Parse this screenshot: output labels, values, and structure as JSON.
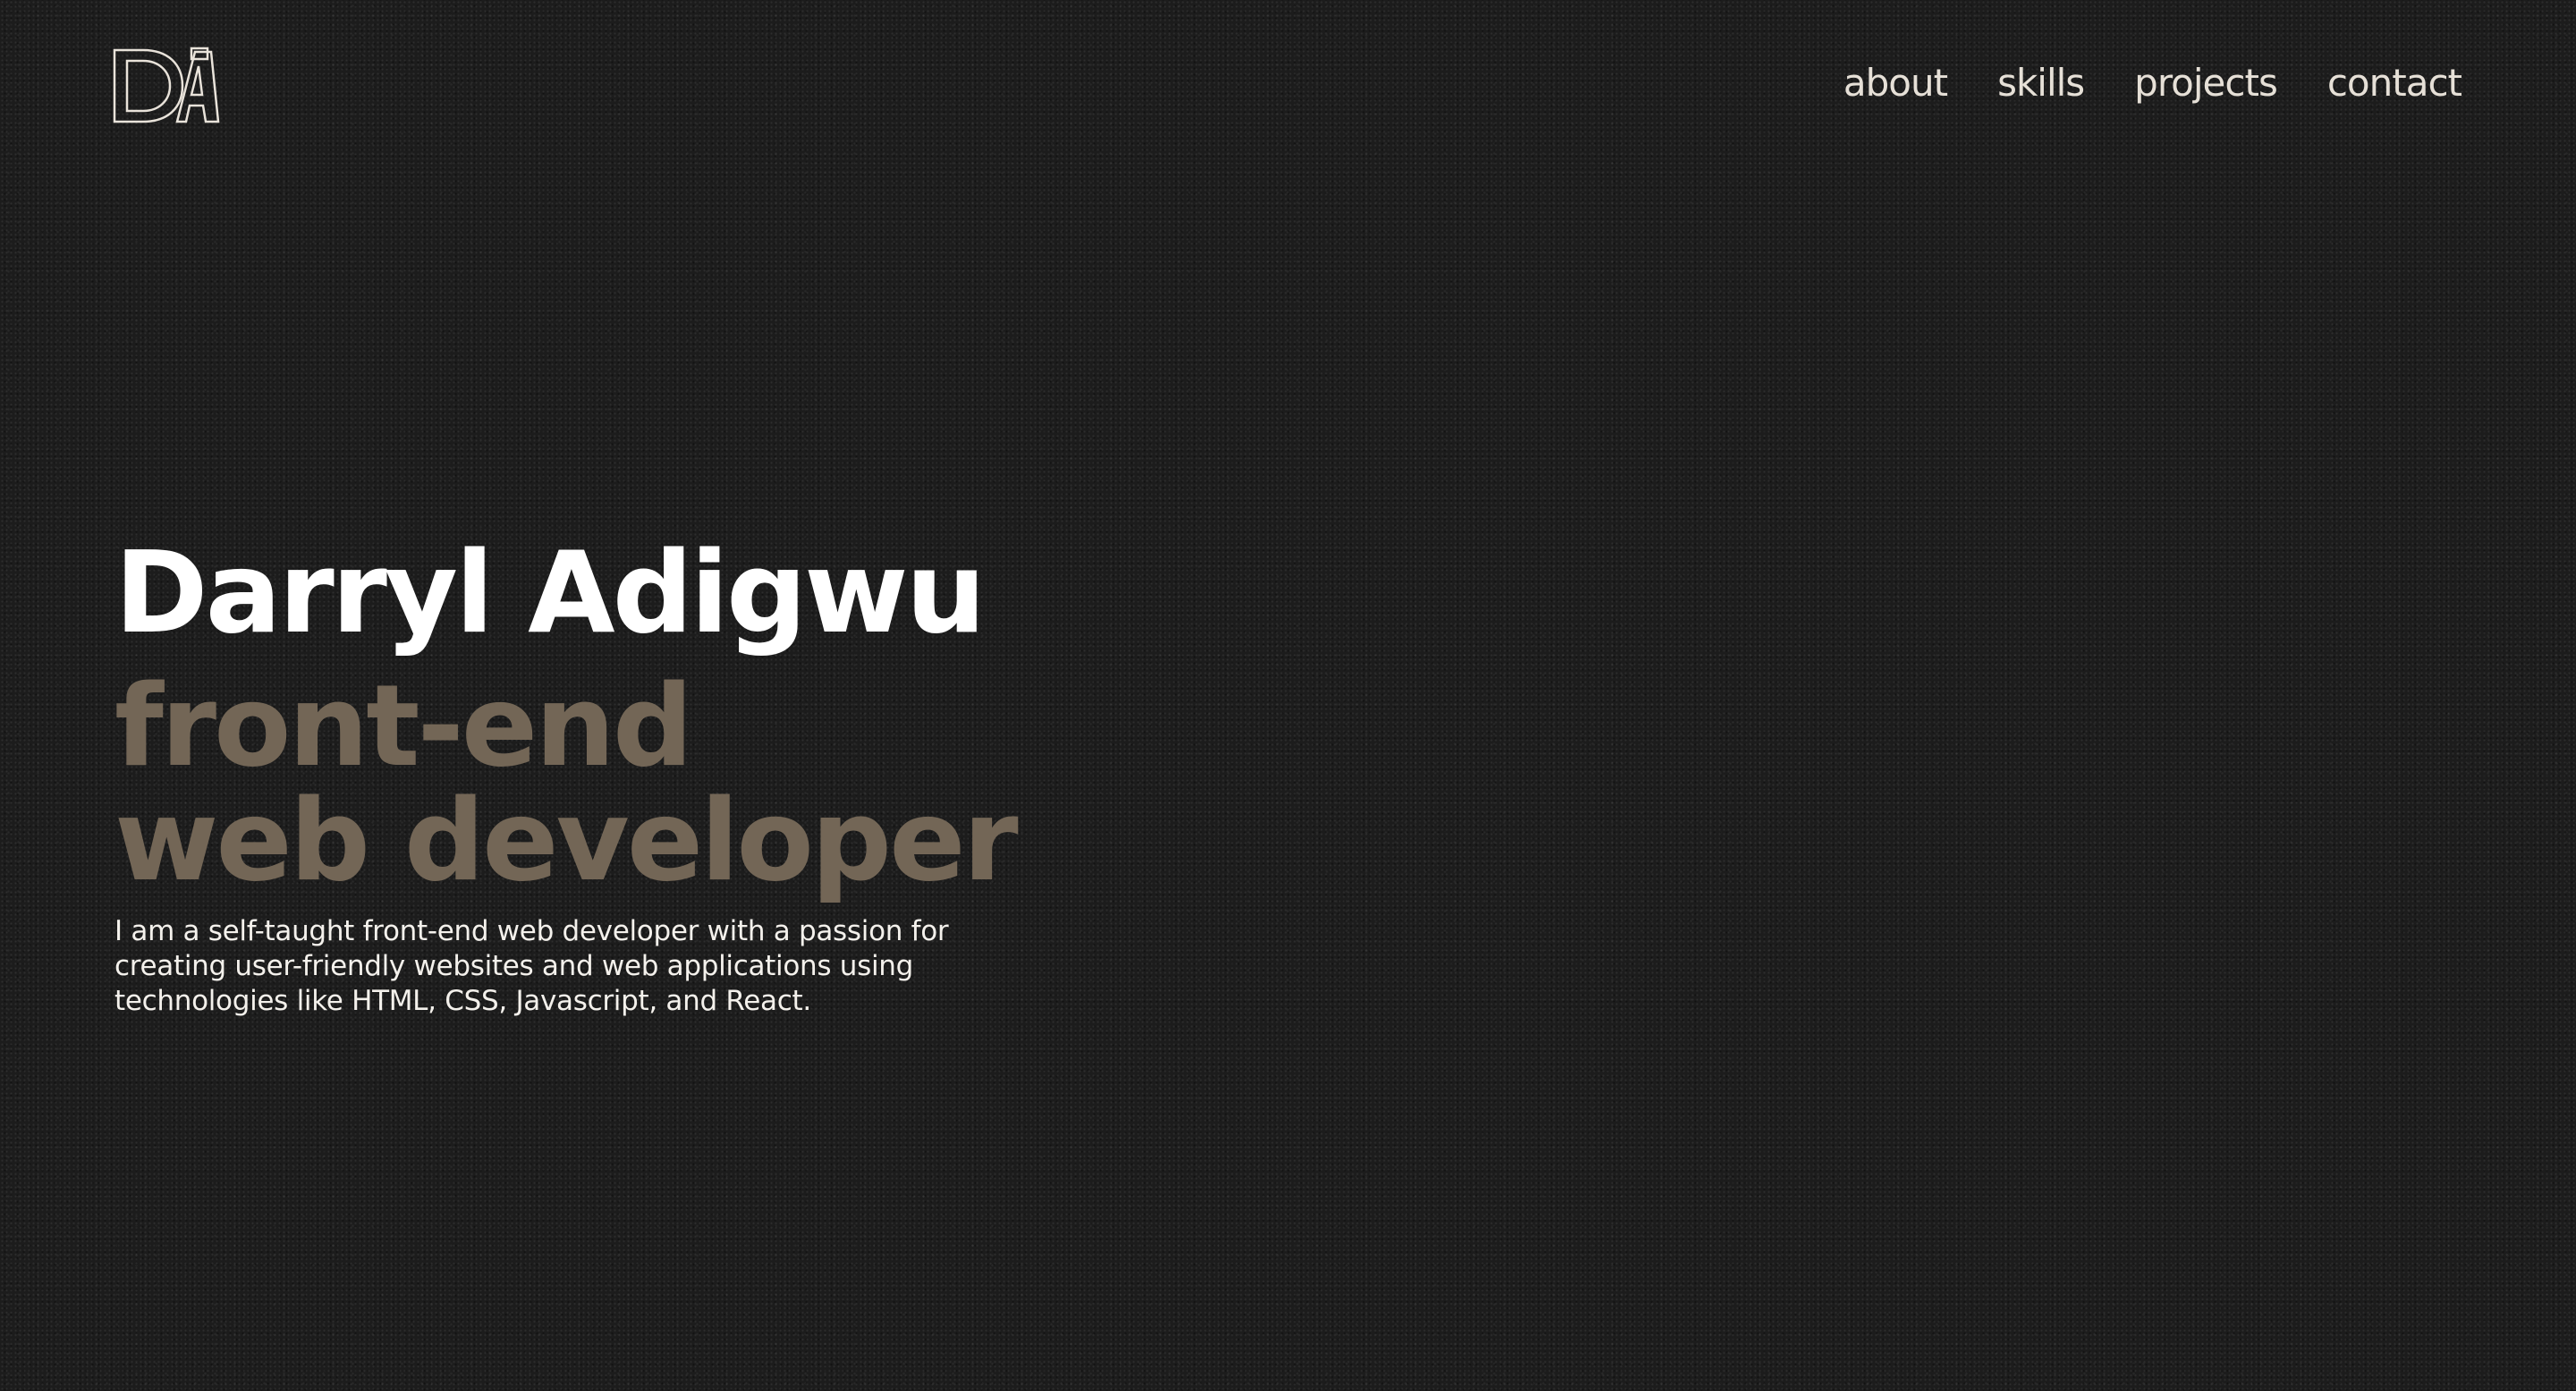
{
  "nav": {
    "logo_icon": "da-monogram-logo",
    "links": [
      "about",
      "skills",
      "projects",
      "contact"
    ]
  },
  "hero": {
    "name": "Darryl Adigwu",
    "role_line1": "front-end",
    "role_line2": "web developer",
    "bio": "I am a self-taught front-end web developer with a passion for creating user-friendly websites and web applications using technologies like HTML, CSS, Javascript, and React."
  },
  "colors": {
    "background": "#1c1c1c",
    "accent": "#736656",
    "text": "#ffffff",
    "nav_text": "#e6e0d7"
  }
}
